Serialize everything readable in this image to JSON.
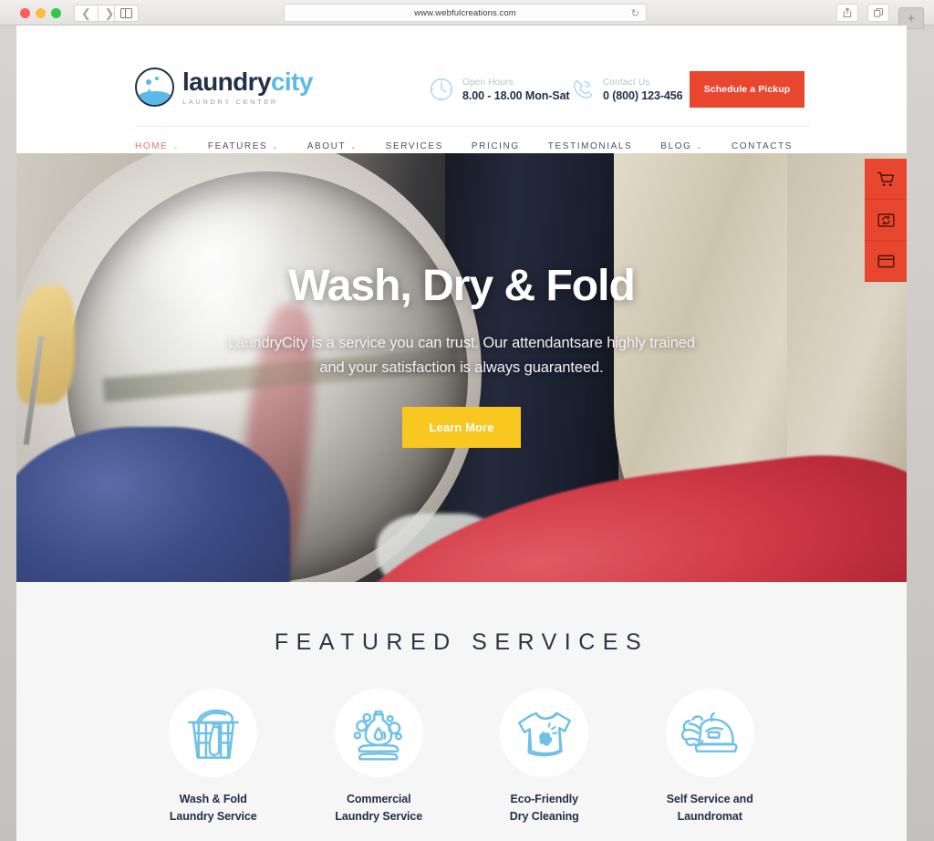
{
  "browser": {
    "url": "www.webfulcreations.com",
    "reload_icon": "reload-icon",
    "back_icon": "chevron-left-icon",
    "forward_icon": "chevron-right-icon",
    "sidebar_icon": "sidebar-toggle-icon",
    "share_icon": "share-icon",
    "tabs_icon": "show-tabs-icon",
    "new_tab_label": "+"
  },
  "site": {
    "logo": {
      "word1": "laundry",
      "word2": "city",
      "tagline": "LAUNDRY CENTER",
      "color1": "#21304a",
      "color2": "#5bb9e8"
    },
    "header_info": [
      {
        "label": "Open Hours",
        "value": "8.00 - 18.00 Mon-Sat",
        "icon": "clock-icon"
      },
      {
        "label": "Contact Us",
        "value": "0 (800) 123-456",
        "icon": "phone-icon"
      }
    ],
    "cta": {
      "label": "Schedule a Pickup",
      "color": "#e8462f"
    },
    "nav": [
      {
        "label": "HOME",
        "caret": "⌄",
        "active": true
      },
      {
        "label": "FEATURES",
        "caret": "⌄",
        "active": false
      },
      {
        "label": "ABOUT",
        "caret": "⌄",
        "active": false
      },
      {
        "label": "SERVICES",
        "caret": "",
        "active": false
      },
      {
        "label": "PRICING",
        "caret": "",
        "active": false
      },
      {
        "label": "TESTIMONIALS",
        "caret": "",
        "active": false
      },
      {
        "label": "BLOG",
        "caret": "⌄",
        "active": false
      },
      {
        "label": "CONTACTS",
        "caret": "",
        "active": false
      }
    ]
  },
  "hero": {
    "title": "Wash, Dry & Fold",
    "subtitle": "LaundryCity is a service you can trust. Our attendantsare highly trained and your satisfaction is always guaranteed.",
    "button_label": "Learn More",
    "button_color": "#f8c821"
  },
  "side_buttons": [
    {
      "icon": "shopping-cart-icon",
      "name": "cart"
    },
    {
      "icon": "refresh-window-icon",
      "name": "sync"
    },
    {
      "icon": "window-panel-icon",
      "name": "panel"
    }
  ],
  "services": {
    "title": "FEATURED SERVICES",
    "items": [
      {
        "name": "Wash & Fold\nLaundry Service",
        "icon": "laundry-basket-icon"
      },
      {
        "name": "Commercial\nLaundry Service",
        "icon": "detergent-bottle-icon"
      },
      {
        "name": "Eco-Friendly\nDry Cleaning",
        "icon": "stained-shirt-icon"
      },
      {
        "name": "Self Service and\nLaundromat",
        "icon": "steam-iron-icon"
      }
    ],
    "icon_color": "#6ec0e8"
  }
}
